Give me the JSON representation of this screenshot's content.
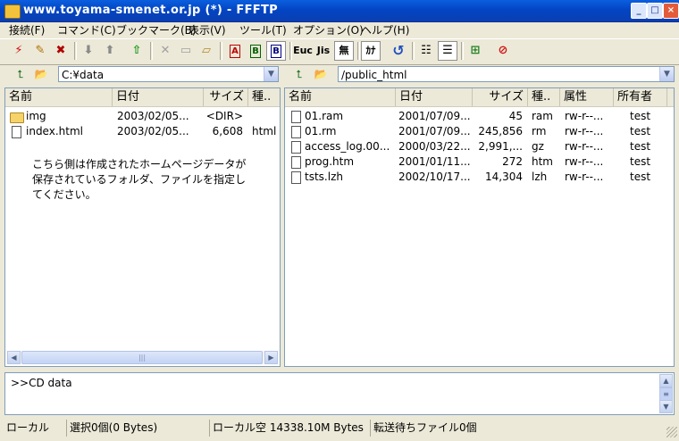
{
  "window": {
    "title": "www.toyama-smenet.or.jp (*) - FFFTP"
  },
  "menu": [
    "接続(F)",
    "コマンド(C)",
    "ブックマーク(B)",
    "表示(V)",
    "ツール(T)",
    "オプション(O)",
    "ヘルプ(H)"
  ],
  "toolbar": {
    "ascii_label": "A",
    "binary_label": "B",
    "auto_label": "B",
    "euc_label": "Euc",
    "jis_label": "Jis",
    "nochange_label": "無",
    "kana_label": "ｶﾅ"
  },
  "local": {
    "path": "C:¥data",
    "columns": [
      "名前",
      "日付",
      "サイズ",
      "種.."
    ],
    "files": [
      {
        "name": "img",
        "date": "2003/02/05...",
        "size": "<DIR>",
        "type": "",
        "icon": "folder-icon"
      },
      {
        "name": "index.html",
        "date": "2003/02/05...",
        "size": "6,608",
        "type": "html",
        "icon": "file-icon"
      }
    ],
    "note": "こちら側は作成されたホームページデータが保存されているフォルダ、ファイルを指定してください。"
  },
  "remote": {
    "path": "/public_html",
    "columns": [
      "名前",
      "日付",
      "サイズ",
      "種..",
      "属性",
      "所有者"
    ],
    "files": [
      {
        "name": "01.ram",
        "date": "2001/07/09...",
        "size": "45",
        "type": "ram",
        "attr": "rw-r--...",
        "owner": "test"
      },
      {
        "name": "01.rm",
        "date": "2001/07/09...",
        "size": "245,856",
        "type": "rm",
        "attr": "rw-r--...",
        "owner": "test"
      },
      {
        "name": "access_log.00...",
        "date": "2000/03/22...",
        "size": "2,991,...",
        "type": "gz",
        "attr": "rw-r--...",
        "owner": "test"
      },
      {
        "name": "prog.htm",
        "date": "2001/01/11...",
        "size": "272",
        "type": "htm",
        "attr": "rw-r--...",
        "owner": "test"
      },
      {
        "name": "tsts.lzh",
        "date": "2002/10/17...",
        "size": "14,304",
        "type": "lzh",
        "attr": "rw-r--...",
        "owner": "test"
      }
    ]
  },
  "log": {
    "text": ">>CD data"
  },
  "status": {
    "mode": "ローカル",
    "selection": "選択0個(0 Bytes)",
    "free_space": "ローカル空 14338.10M Bytes",
    "queue": "転送待ちファイル0個"
  }
}
